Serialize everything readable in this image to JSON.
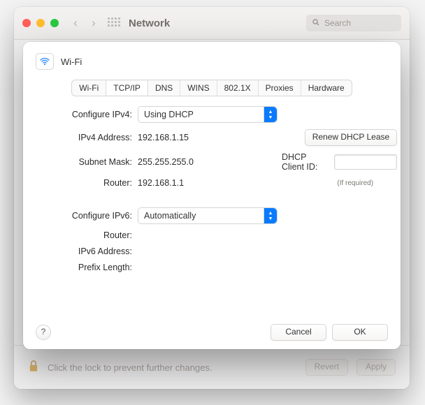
{
  "window": {
    "title": "Network",
    "search_placeholder": "Search",
    "lock_text": "Click the lock to prevent further changes.",
    "revert_label": "Revert",
    "apply_label": "Apply"
  },
  "sheet": {
    "interface_title": "Wi-Fi",
    "tabs": {
      "wifi": "Wi-Fi",
      "tcpip": "TCP/IP",
      "dns": "DNS",
      "wins": "WINS",
      "dot1x": "802.1X",
      "proxies": "Proxies",
      "hardware": "Hardware"
    },
    "ipv4": {
      "configure_label": "Configure IPv4:",
      "configure_value": "Using DHCP",
      "address_label": "IPv4 Address:",
      "address_value": "192.168.1.15",
      "subnet_label": "Subnet Mask:",
      "subnet_value": "255.255.255.0",
      "router_label": "Router:",
      "router_value": "192.168.1.1",
      "renew_label": "Renew DHCP Lease",
      "client_id_label": "DHCP Client ID:",
      "client_id_hint": "(If required)"
    },
    "ipv6": {
      "configure_label": "Configure IPv6:",
      "configure_value": "Automatically",
      "router_label": "Router:",
      "address_label": "IPv6 Address:",
      "prefix_label": "Prefix Length:"
    },
    "footer": {
      "cancel_label": "Cancel",
      "ok_label": "OK",
      "help_label": "?"
    }
  }
}
